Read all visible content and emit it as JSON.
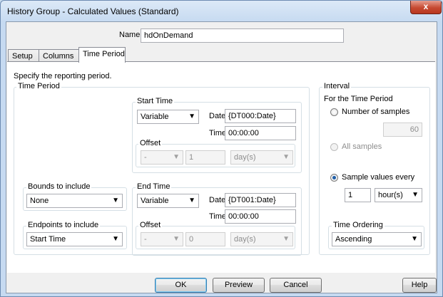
{
  "window": {
    "title": "History Group - Calculated Values (Standard)",
    "close_glyph": "x"
  },
  "name_field": {
    "label": "Name",
    "value": "hdOnDemand"
  },
  "tabs": [
    {
      "label": "Setup"
    },
    {
      "label": "Columns"
    },
    {
      "label": "Time Period"
    }
  ],
  "instruction": "Specify the reporting period.",
  "time_period": {
    "title": "Time Period",
    "start": {
      "title": "Start Time",
      "mode": "Variable",
      "date_label": "Date",
      "date_value": "{DT000:Date}",
      "time_label": "Time",
      "time_value": "00:00:00",
      "offset": {
        "title": "Offset",
        "sign": "-",
        "amount": "1",
        "unit": "day(s)"
      }
    },
    "end": {
      "title": "End Time",
      "mode": "Variable",
      "date_label": "Date",
      "date_value": "{DT001:Date}",
      "time_label": "Time",
      "time_value": "00:00:00",
      "offset": {
        "title": "Offset",
        "sign": "-",
        "amount": "0",
        "unit": "day(s)"
      }
    },
    "bounds": {
      "title": "Bounds to include",
      "value": "None"
    },
    "endpoints": {
      "title": "Endpoints to include",
      "value": "Start Time"
    }
  },
  "interval": {
    "title": "Interval",
    "subtitle": "For the Time Period",
    "num_samples_label": "Number of samples",
    "num_samples_value": "60",
    "all_samples_label": "All samples",
    "sample_every_label": "Sample values every",
    "sample_every_value": "1",
    "sample_every_unit": "hour(s)",
    "ordering": {
      "title": "Time Ordering",
      "value": "Ascending"
    }
  },
  "buttons": {
    "ok": "OK",
    "preview": "Preview",
    "cancel": "Cancel",
    "help": "Help"
  },
  "icons": {
    "dropdown_arrow": "▼"
  }
}
